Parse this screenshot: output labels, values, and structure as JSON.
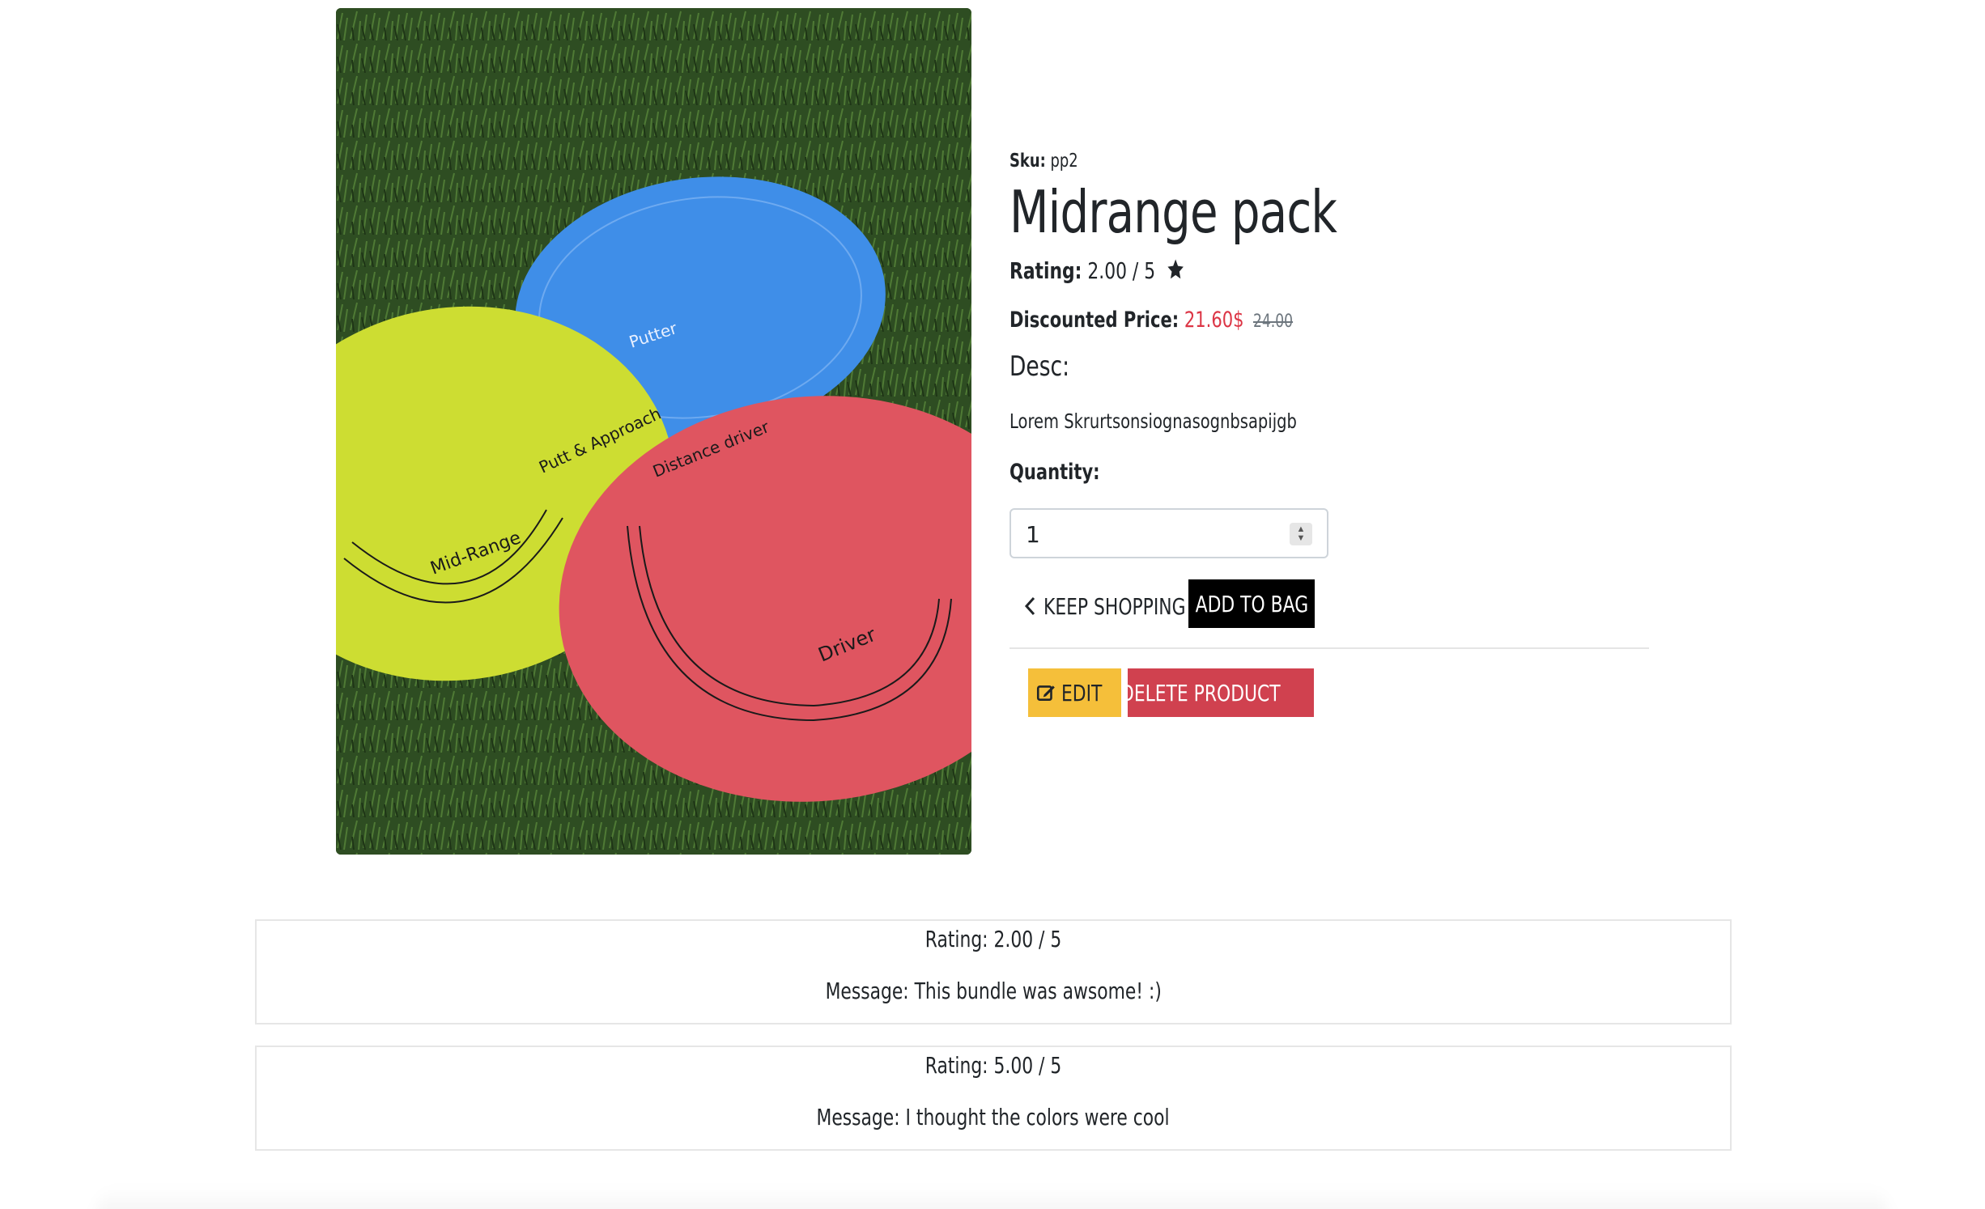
{
  "product": {
    "image_alt": "Three golf discs on grass",
    "disc_labels": {
      "putter_top": "Putt & Approach",
      "putter": "Putter",
      "midrange": "Mid-Range",
      "driver_top": "Distance driver",
      "driver": "Driver"
    },
    "sku_label": "Sku:",
    "sku": "pp2",
    "title": "Midrange pack",
    "rating_label": "Rating:",
    "rating_value": "2.00 / 5",
    "price_label": "Discounted Price:",
    "price_new": "21.60$",
    "price_old": "24.00",
    "desc_label": "Desc:",
    "description": "Lorem Skrurtsonsiognasognbsapijgb",
    "quantity_label": "Quantity:",
    "quantity_value": "1"
  },
  "actions": {
    "keep_shopping": "KEEP SHOPPING",
    "add_to_bag": "ADD TO BAG",
    "edit": "EDIT",
    "delete": "DELETE PRODUCT"
  },
  "reviews": [
    {
      "rating": "Rating: 2.00 / 5",
      "message": "Message: This bundle was awsome! :)"
    },
    {
      "rating": "Rating: 5.00 / 5",
      "message": "Message: I thought the colors were cool"
    }
  ],
  "colors": {
    "price_new": "#dc3545",
    "edit_button": "#f5bf3a",
    "delete_button": "#d0414f",
    "add_to_bag": "#000000"
  }
}
